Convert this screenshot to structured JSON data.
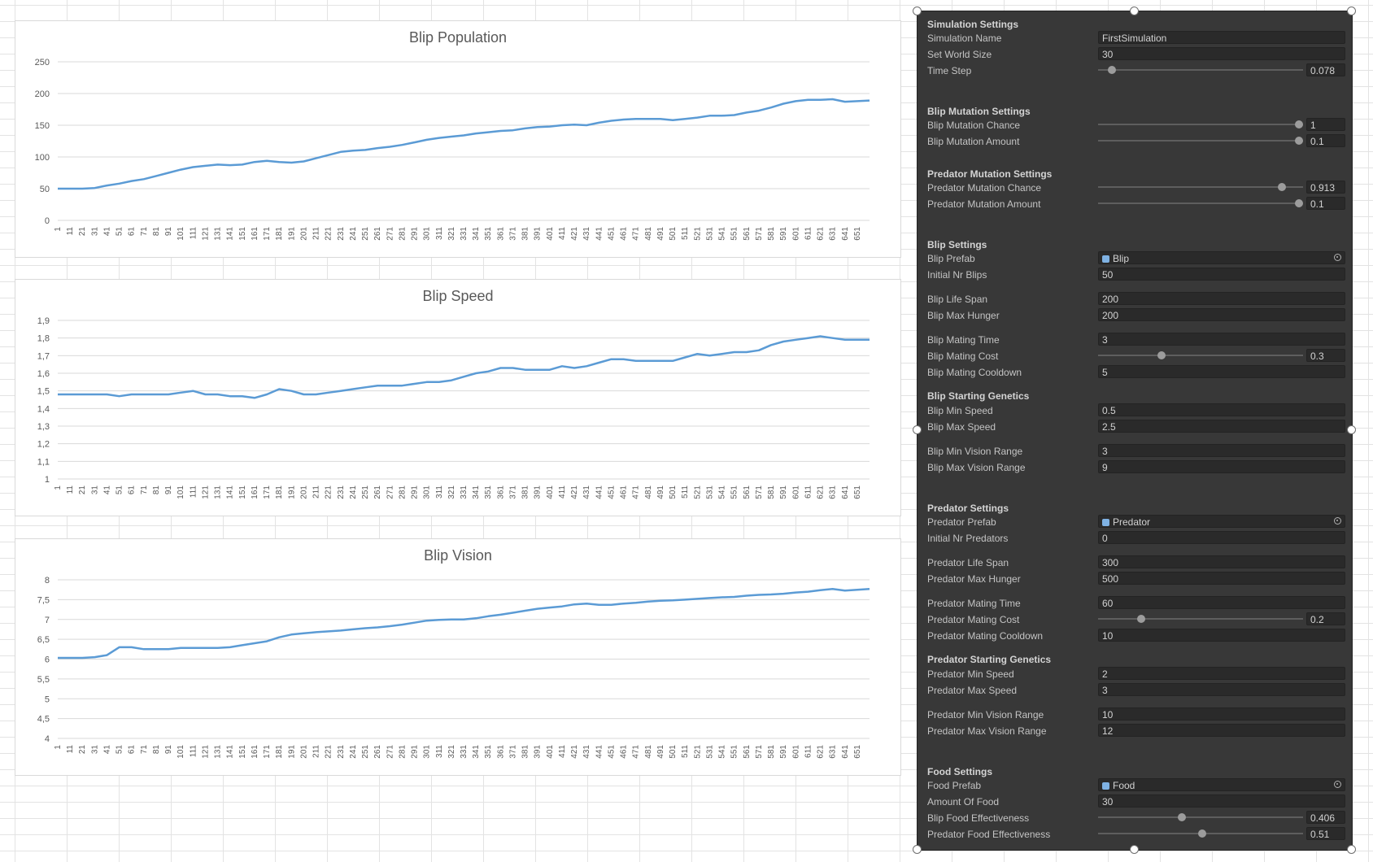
{
  "charts": [
    {
      "title": "Blip Population",
      "yticks": [
        "250",
        "200",
        "150",
        "100",
        "50",
        "0"
      ],
      "xticks": [
        "1",
        "11",
        "21",
        "31",
        "41",
        "51",
        "61",
        "71",
        "81",
        "91",
        "101",
        "111",
        "121",
        "131",
        "141",
        "151",
        "161",
        "171",
        "181",
        "191",
        "201",
        "211",
        "221",
        "231",
        "241",
        "251",
        "261",
        "271",
        "281",
        "291",
        "301",
        "311",
        "321",
        "331",
        "341",
        "351",
        "361",
        "371",
        "381",
        "391",
        "401",
        "411",
        "421",
        "431",
        "441",
        "451",
        "461",
        "471",
        "481",
        "491",
        "501",
        "511",
        "521",
        "531",
        "541",
        "551",
        "561",
        "571",
        "581",
        "591",
        "601",
        "611",
        "621",
        "631",
        "641",
        "651"
      ]
    },
    {
      "title": "Blip Speed",
      "yticks": [
        "1,9",
        "1,8",
        "1,7",
        "1,6",
        "1,5",
        "1,4",
        "1,3",
        "1,2",
        "1,1",
        "1"
      ],
      "xticks": [
        "1",
        "11",
        "21",
        "31",
        "41",
        "51",
        "61",
        "71",
        "81",
        "91",
        "101",
        "111",
        "121",
        "131",
        "141",
        "151",
        "161",
        "171",
        "181",
        "191",
        "201",
        "211",
        "221",
        "231",
        "241",
        "251",
        "261",
        "271",
        "281",
        "291",
        "301",
        "311",
        "321",
        "331",
        "341",
        "351",
        "361",
        "371",
        "381",
        "391",
        "401",
        "411",
        "421",
        "431",
        "441",
        "451",
        "461",
        "471",
        "481",
        "491",
        "501",
        "511",
        "521",
        "531",
        "541",
        "551",
        "561",
        "571",
        "581",
        "591",
        "601",
        "611",
        "621",
        "631",
        "641",
        "651"
      ]
    },
    {
      "title": "Blip Vision",
      "yticks": [
        "8",
        "7,5",
        "7",
        "6,5",
        "6",
        "5,5",
        "5",
        "4,5",
        "4"
      ],
      "xticks": [
        "1",
        "11",
        "21",
        "31",
        "41",
        "51",
        "61",
        "71",
        "81",
        "91",
        "101",
        "111",
        "121",
        "131",
        "141",
        "151",
        "161",
        "171",
        "181",
        "191",
        "201",
        "211",
        "221",
        "231",
        "241",
        "251",
        "261",
        "271",
        "281",
        "291",
        "301",
        "311",
        "321",
        "331",
        "341",
        "351",
        "361",
        "371",
        "381",
        "391",
        "401",
        "411",
        "421",
        "431",
        "441",
        "451",
        "461",
        "471",
        "481",
        "491",
        "501",
        "511",
        "521",
        "531",
        "541",
        "551",
        "561",
        "571",
        "581",
        "591",
        "601",
        "611",
        "621",
        "631",
        "641",
        "651"
      ]
    }
  ],
  "chart_data": [
    {
      "type": "line",
      "title": "Blip Population",
      "xlabel": "",
      "ylabel": "",
      "ylim": [
        0,
        250
      ],
      "grid": true,
      "x": [
        1,
        11,
        21,
        31,
        41,
        51,
        61,
        71,
        81,
        91,
        101,
        111,
        121,
        131,
        141,
        151,
        161,
        171,
        181,
        191,
        201,
        211,
        221,
        231,
        241,
        251,
        261,
        271,
        281,
        291,
        301,
        311,
        321,
        331,
        341,
        351,
        361,
        371,
        381,
        391,
        401,
        411,
        421,
        431,
        441,
        451,
        461,
        471,
        481,
        491,
        501,
        511,
        521,
        531,
        541,
        551,
        561,
        571,
        581,
        591,
        601,
        611,
        621,
        631,
        641,
        651,
        661
      ],
      "series": [
        {
          "values": [
            50,
            50,
            50,
            51,
            55,
            58,
            62,
            65,
            70,
            75,
            80,
            84,
            86,
            88,
            87,
            88,
            92,
            94,
            92,
            91,
            93,
            98,
            103,
            108,
            110,
            111,
            114,
            116,
            119,
            123,
            127,
            130,
            132,
            134,
            137,
            139,
            141,
            142,
            145,
            147,
            148,
            150,
            151,
            150,
            154,
            157,
            159,
            160,
            160,
            160,
            158,
            160,
            162,
            165,
            165,
            166,
            170,
            173,
            178,
            184,
            188,
            190,
            190,
            191,
            187,
            188,
            189
          ]
        }
      ]
    },
    {
      "type": "line",
      "title": "Blip Speed",
      "xlabel": "",
      "ylabel": "",
      "ylim": [
        1,
        1.9
      ],
      "grid": true,
      "x": [
        1,
        11,
        21,
        31,
        41,
        51,
        61,
        71,
        81,
        91,
        101,
        111,
        121,
        131,
        141,
        151,
        161,
        171,
        181,
        191,
        201,
        211,
        221,
        231,
        241,
        251,
        261,
        271,
        281,
        291,
        301,
        311,
        321,
        331,
        341,
        351,
        361,
        371,
        381,
        391,
        401,
        411,
        421,
        431,
        441,
        451,
        461,
        471,
        481,
        491,
        501,
        511,
        521,
        531,
        541,
        551,
        561,
        571,
        581,
        591,
        601,
        611,
        621,
        631,
        641,
        651,
        661
      ],
      "series": [
        {
          "values": [
            1.48,
            1.48,
            1.48,
            1.48,
            1.48,
            1.47,
            1.48,
            1.48,
            1.48,
            1.48,
            1.49,
            1.5,
            1.48,
            1.48,
            1.47,
            1.47,
            1.46,
            1.48,
            1.51,
            1.5,
            1.48,
            1.48,
            1.49,
            1.5,
            1.51,
            1.52,
            1.53,
            1.53,
            1.53,
            1.54,
            1.55,
            1.55,
            1.56,
            1.58,
            1.6,
            1.61,
            1.63,
            1.63,
            1.62,
            1.62,
            1.62,
            1.64,
            1.63,
            1.64,
            1.66,
            1.68,
            1.68,
            1.67,
            1.67,
            1.67,
            1.67,
            1.69,
            1.71,
            1.7,
            1.71,
            1.72,
            1.72,
            1.73,
            1.76,
            1.78,
            1.79,
            1.8,
            1.81,
            1.8,
            1.79,
            1.79,
            1.79
          ]
        }
      ]
    },
    {
      "type": "line",
      "title": "Blip Vision",
      "xlabel": "",
      "ylabel": "",
      "ylim": [
        4,
        8
      ],
      "grid": true,
      "x": [
        1,
        11,
        21,
        31,
        41,
        51,
        61,
        71,
        81,
        91,
        101,
        111,
        121,
        131,
        141,
        151,
        161,
        171,
        181,
        191,
        201,
        211,
        221,
        231,
        241,
        251,
        261,
        271,
        281,
        291,
        301,
        311,
        321,
        331,
        341,
        351,
        361,
        371,
        381,
        391,
        401,
        411,
        421,
        431,
        441,
        451,
        461,
        471,
        481,
        491,
        501,
        511,
        521,
        531,
        541,
        551,
        561,
        571,
        581,
        591,
        601,
        611,
        621,
        631,
        641,
        651,
        661
      ],
      "series": [
        {
          "values": [
            6.03,
            6.03,
            6.03,
            6.05,
            6.1,
            6.3,
            6.3,
            6.25,
            6.25,
            6.25,
            6.28,
            6.28,
            6.28,
            6.28,
            6.3,
            6.35,
            6.4,
            6.45,
            6.55,
            6.62,
            6.65,
            6.68,
            6.7,
            6.72,
            6.75,
            6.78,
            6.8,
            6.83,
            6.87,
            6.92,
            6.97,
            6.99,
            7.0,
            7.0,
            7.03,
            7.08,
            7.12,
            7.17,
            7.22,
            7.27,
            7.3,
            7.33,
            7.38,
            7.4,
            7.37,
            7.37,
            7.4,
            7.42,
            7.45,
            7.47,
            7.48,
            7.5,
            7.52,
            7.54,
            7.56,
            7.57,
            7.6,
            7.62,
            7.63,
            7.65,
            7.68,
            7.7,
            7.74,
            7.77,
            7.73,
            7.75,
            7.77
          ]
        }
      ]
    }
  ],
  "inspector": {
    "simulation_settings": "Simulation Settings",
    "simulation_name_label": "Simulation Name",
    "simulation_name": "FirstSimulation",
    "set_world_size_label": "Set World Size",
    "set_world_size": "30",
    "time_step_label": "Time Step",
    "time_step": "0.078",
    "time_step_fraction": 0.05,
    "blip_mutation_settings": "Blip Mutation Settings",
    "blip_mutation_chance_label": "Blip Mutation Chance",
    "blip_mutation_chance": "1",
    "blip_mutation_chance_fraction": 1.0,
    "blip_mutation_amount_label": "Blip Mutation Amount",
    "blip_mutation_amount": "0.1",
    "blip_mutation_amount_fraction": 1.0,
    "predator_mutation_settings": "Predator Mutation Settings",
    "predator_mutation_chance_label": "Predator Mutation Chance",
    "predator_mutation_chance": "0.913",
    "predator_mutation_chance_fraction": 0.913,
    "predator_mutation_amount_label": "Predator Mutation Amount",
    "predator_mutation_amount": "0.1",
    "predator_mutation_amount_fraction": 1.0,
    "blip_settings": "Blip Settings",
    "blip_prefab_label": "Blip Prefab",
    "blip_prefab": "Blip",
    "initial_nr_blips_label": "Initial Nr Blips",
    "initial_nr_blips": "50",
    "blip_life_span_label": "Blip Life Span",
    "blip_life_span": "200",
    "blip_max_hunger_label": "Blip Max Hunger",
    "blip_max_hunger": "200",
    "blip_mating_time_label": "Blip Mating Time",
    "blip_mating_time": "3",
    "blip_mating_cost_label": "Blip Mating Cost",
    "blip_mating_cost": "0.3",
    "blip_mating_cost_fraction": 0.3,
    "blip_mating_cooldown_label": "Blip Mating Cooldown",
    "blip_mating_cooldown": "5",
    "blip_starting_genetics": "Blip Starting Genetics",
    "blip_min_speed_label": "Blip Min Speed",
    "blip_min_speed": "0.5",
    "blip_max_speed_label": "Blip Max Speed",
    "blip_max_speed": "2.5",
    "blip_min_vision_range_label": "Blip Min Vision Range",
    "blip_min_vision_range": "3",
    "blip_max_vision_range_label": "Blip Max Vision Range",
    "blip_max_vision_range": "9",
    "predator_settings": "Predator Settings",
    "predator_prefab_label": "Predator Prefab",
    "predator_prefab": "Predator",
    "initial_nr_predators_label": "Initial Nr Predators",
    "initial_nr_predators": "0",
    "predator_life_span_label": "Predator Life Span",
    "predator_life_span": "300",
    "predator_max_hunger_label": "Predator Max Hunger",
    "predator_max_hunger": "500",
    "predator_mating_time_label": "Predator Mating Time",
    "predator_mating_time": "60",
    "predator_mating_cost_label": "Predator Mating Cost",
    "predator_mating_cost": "0.2",
    "predator_mating_cost_fraction": 0.2,
    "predator_mating_cooldown_label": "Predator Mating Cooldown",
    "predator_mating_cooldown": "10",
    "predator_starting_genetics": "Predator Starting Genetics",
    "predator_min_speed_label": "Predator Min Speed",
    "predator_min_speed": "2",
    "predator_max_speed_label": "Predator Max Speed",
    "predator_max_speed": "3",
    "predator_min_vision_range_label": "Predator Min Vision Range",
    "predator_min_vision_range": "10",
    "predator_max_vision_range_label": "Predator Max Vision Range",
    "predator_max_vision_range": "12",
    "food_settings": "Food Settings",
    "food_prefab_label": "Food Prefab",
    "food_prefab": "Food",
    "amount_of_food_label": "Amount Of Food",
    "amount_of_food": "30",
    "blip_food_effectiveness_label": "Blip Food Effectiveness",
    "blip_food_effectiveness": "0.406",
    "blip_food_effectiveness_fraction": 0.406,
    "predator_food_effectiveness_label": "Predator Food Effectiveness",
    "predator_food_effectiveness": "0.51",
    "predator_food_effectiveness_fraction": 0.51
  },
  "colors": {
    "series": "#5b9bd5",
    "panel": "#383838",
    "field": "#2a2a2a"
  }
}
